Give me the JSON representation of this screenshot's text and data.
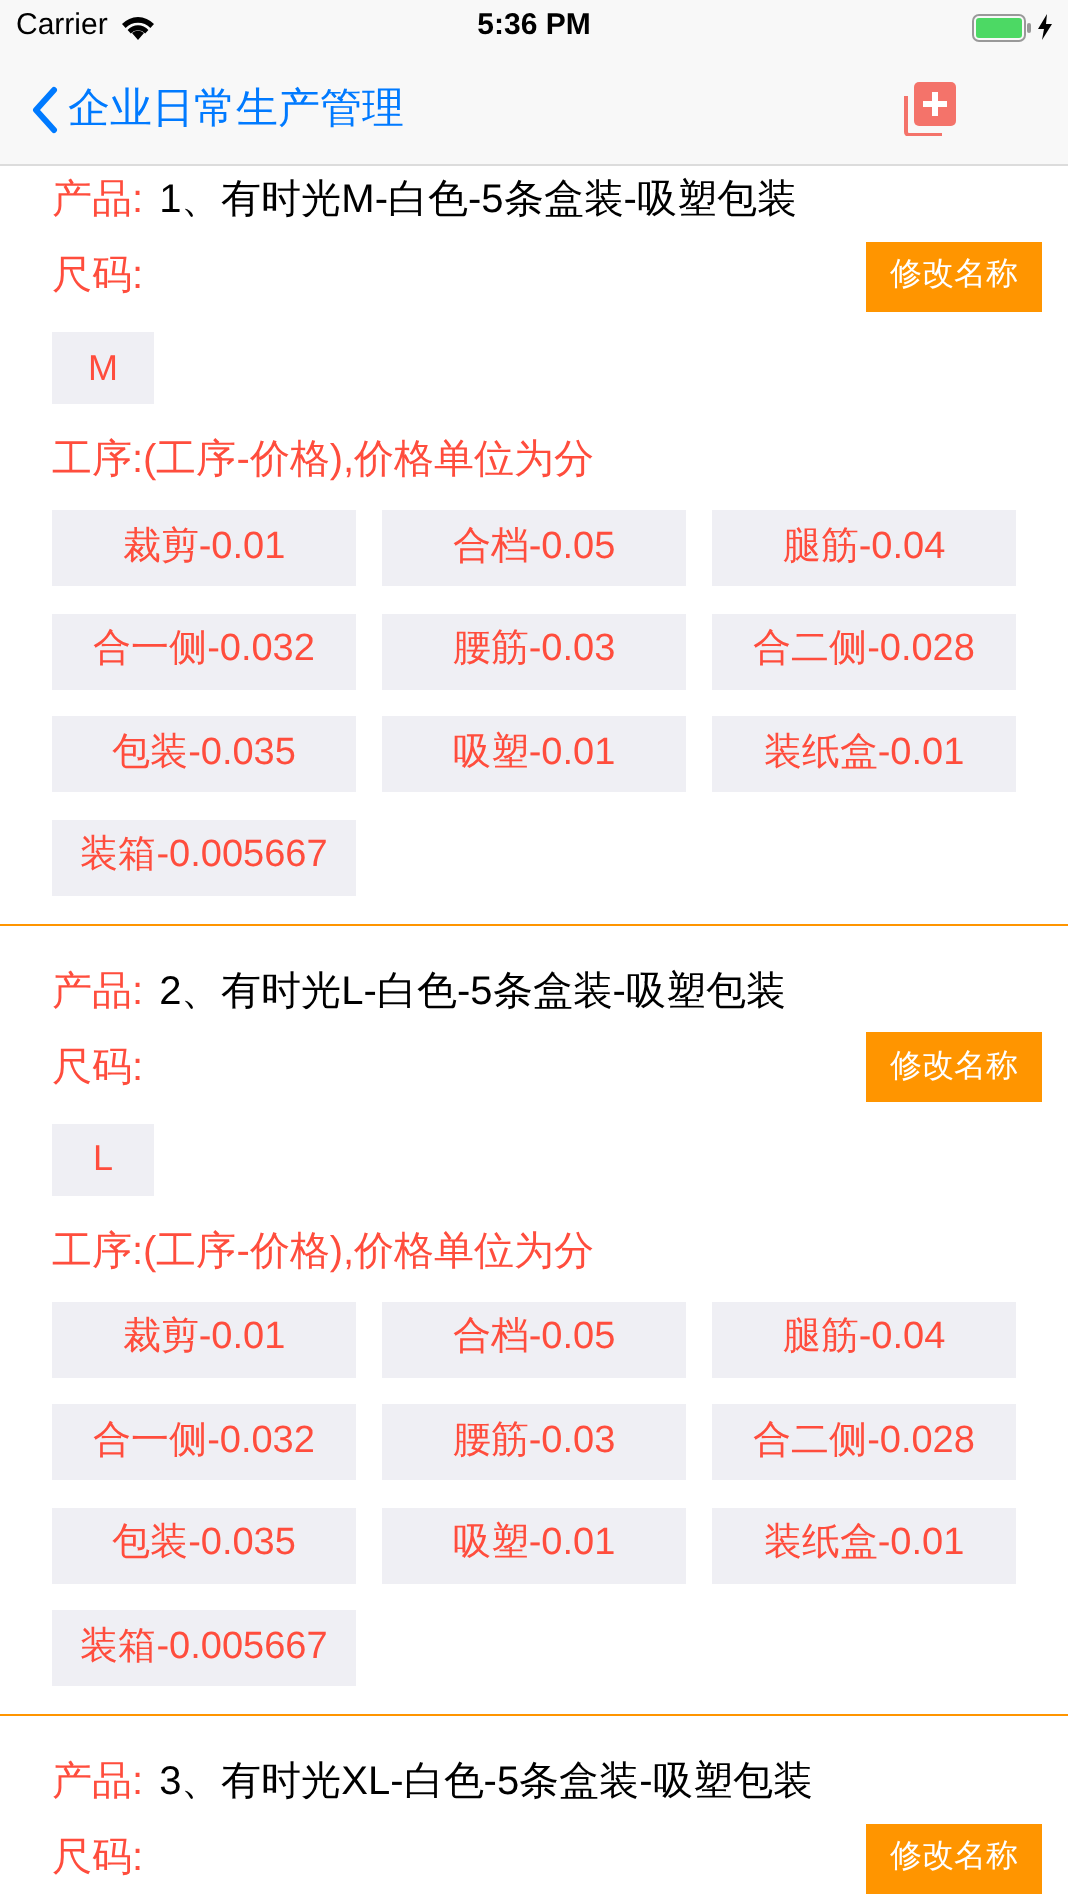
{
  "status_bar": {
    "carrier": "Carrier",
    "time": "5:36 PM"
  },
  "nav": {
    "back_label": "企业日常生产管理"
  },
  "products": [
    {
      "product_label": "产品:",
      "name": "1、有时光M-白色-5条盒装-吸塑包装",
      "size_label": "尺码:",
      "rename_button": "修改名称",
      "sizes": [
        "M"
      ],
      "process_label": "工序:(工序-价格),价格单位为分",
      "processes": [
        "裁剪-0.01",
        "合档-0.05",
        "腿筋-0.04",
        "合一侧-0.032",
        "腰筋-0.03",
        "合二侧-0.028",
        "包装-0.035",
        "吸塑-0.01",
        "装纸盒-0.01",
        "装箱-0.005667"
      ]
    },
    {
      "product_label": "产品:",
      "name": "2、有时光L-白色-5条盒装-吸塑包装",
      "size_label": "尺码:",
      "rename_button": "修改名称",
      "sizes": [
        "L"
      ],
      "process_label": "工序:(工序-价格),价格单位为分",
      "processes": [
        "裁剪-0.01",
        "合档-0.05",
        "腿筋-0.04",
        "合一侧-0.032",
        "腰筋-0.03",
        "合二侧-0.028",
        "包装-0.035",
        "吸塑-0.01",
        "装纸盒-0.01",
        "装箱-0.005667"
      ]
    },
    {
      "product_label": "产品:",
      "name": "3、有时光XL-白色-5条盒装-吸塑包装",
      "size_label": "尺码:",
      "rename_button": "修改名称"
    }
  ]
}
